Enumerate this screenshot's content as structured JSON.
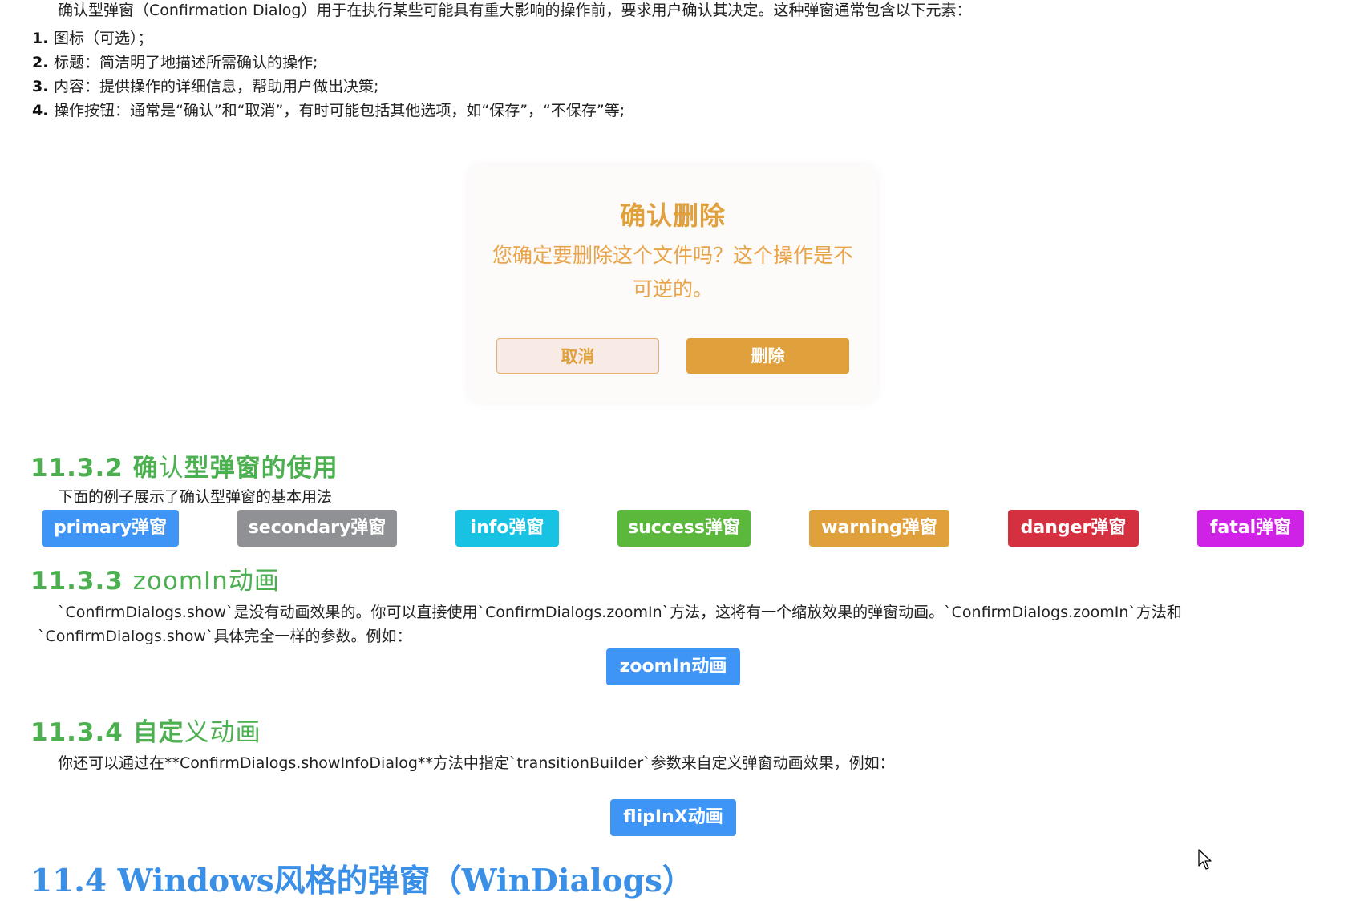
{
  "intro": "确认型弹窗（Confirmation Dialog）用于在执行某些可能具有重大影响的操作前，要求用户确认其决定。这种弹窗通常包含以下元素：",
  "list": [
    {
      "num": "1.",
      "text": "图标（可选）；"
    },
    {
      "num": "2.",
      "text": "标题：简洁明了地描述所需确认的操作;"
    },
    {
      "num": "3.",
      "text": "内容：提供操作的详细信息，帮助用户做出决策;"
    },
    {
      "num": "4.",
      "text": "操作按钮：通常是“确认”和“取消”，有时可能包括其他选项，如“保存”，“不保存”等;"
    }
  ],
  "dialog": {
    "title": "确认删除",
    "message": "您确定要删除这个文件吗？这个操作是不可逆的。",
    "cancel_label": "取消",
    "delete_label": "删除",
    "accent_color": "#e0a03c"
  },
  "section_usage": {
    "heading_num": "11.3.2 ",
    "heading_bold_1": "确",
    "heading_light": "认",
    "heading_bold_2": "型弹窗的使用",
    "description": "下面的例子展示了确认型弹窗的基本用法",
    "buttons": [
      {
        "label": "primary弹窗",
        "color": "#3f95f5"
      },
      {
        "label": "secondary弹窗",
        "color": "#8f9194"
      },
      {
        "label": "info弹窗",
        "color": "#17c2e2"
      },
      {
        "label": "success弹窗",
        "color": "#5cb83c"
      },
      {
        "label": "warning弹窗",
        "color": "#e0a03c"
      },
      {
        "label": "danger弹窗",
        "color": "#d4303f"
      },
      {
        "label": "fatal弹窗",
        "color": "#d022e6"
      }
    ]
  },
  "section_zoom": {
    "heading_bold": "11.3.3 ",
    "heading_light": "zoomIn动画",
    "para_line1": "`ConfirmDialogs.show`是没有动画效果的。你可以直接使用`ConfirmDialogs.zoomIn`方法，这将有一个缩放效果的弹窗动画。`ConfirmDialogs.zoomIn`方法和",
    "para_line2": "`ConfirmDialogs.show`具体完全一样的参数。例如：",
    "button_label": "zoomIn动画",
    "button_color": "#3f95f5"
  },
  "section_custom": {
    "heading_bold_1": "11.3.4 自定",
    "heading_light": "义动画",
    "description": "你还可以通过在**ConfirmDialogs.showInfoDialog**方法中指定`transitionBuilder`参数来自定义弹窗动画效果，例如：",
    "button_label": "flipInX动画",
    "button_color": "#3f95f5"
  },
  "next_section": {
    "heading": "11.4 Windows风格的弹窗（WinDialogs）"
  },
  "cursor_icon": "mouse-pointer-icon"
}
